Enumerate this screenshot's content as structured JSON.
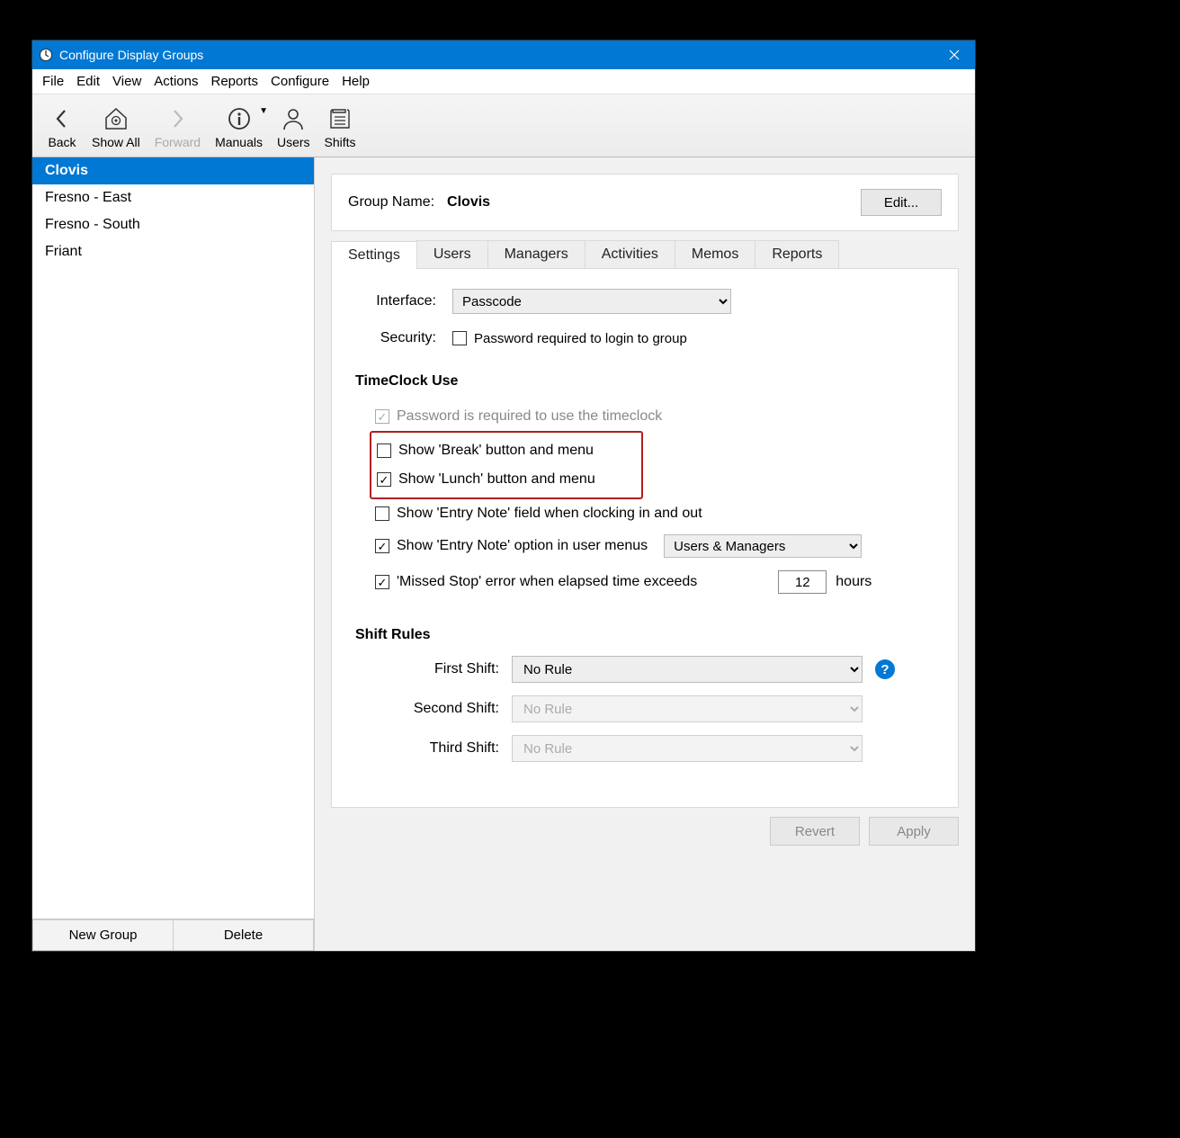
{
  "window": {
    "title": "Configure Display Groups"
  },
  "menu": {
    "items": [
      "File",
      "Edit",
      "View",
      "Actions",
      "Reports",
      "Configure",
      "Help"
    ]
  },
  "toolbar": {
    "back": "Back",
    "showall": "Show All",
    "forward": "Forward",
    "manuals": "Manuals",
    "users": "Users",
    "shifts": "Shifts"
  },
  "sidebar": {
    "items": [
      {
        "label": "Clovis",
        "selected": true
      },
      {
        "label": "Fresno - East",
        "selected": false
      },
      {
        "label": "Fresno - South",
        "selected": false
      },
      {
        "label": "Friant",
        "selected": false
      }
    ],
    "new_group": "New Group",
    "delete": "Delete"
  },
  "header": {
    "label": "Group Name:",
    "value": "Clovis",
    "edit": "Edit..."
  },
  "tabs": [
    "Settings",
    "Users",
    "Managers",
    "Activities",
    "Memos",
    "Reports"
  ],
  "active_tab": 0,
  "settings": {
    "interface_label": "Interface:",
    "interface_value": "Passcode",
    "security_label": "Security:",
    "security_check": "Password required to login to group",
    "security_checked": false,
    "timeclock_title": "TimeClock Use",
    "opts": {
      "pw_required": {
        "label": "Password is required to use the timeclock",
        "checked": true,
        "disabled": true
      },
      "show_break": {
        "label": "Show 'Break' button and menu",
        "checked": false
      },
      "show_lunch": {
        "label": "Show 'Lunch' button and menu",
        "checked": true
      },
      "entry_note_field": {
        "label": "Show 'Entry Note' field when clocking in and out",
        "checked": false
      },
      "entry_note_menu": {
        "label": "Show 'Entry Note' option in user menus",
        "checked": true,
        "select": "Users & Managers"
      },
      "missed_stop": {
        "label": "'Missed Stop' error when elapsed time exceeds",
        "checked": true,
        "value": "12",
        "unit": "hours"
      }
    },
    "shift_title": "Shift Rules",
    "shifts": {
      "first": {
        "label": "First Shift:",
        "value": "No Rule",
        "enabled": true
      },
      "second": {
        "label": "Second Shift:",
        "value": "No Rule",
        "enabled": false
      },
      "third": {
        "label": "Third Shift:",
        "value": "No Rule",
        "enabled": false
      }
    }
  },
  "footer": {
    "revert": "Revert",
    "apply": "Apply"
  }
}
